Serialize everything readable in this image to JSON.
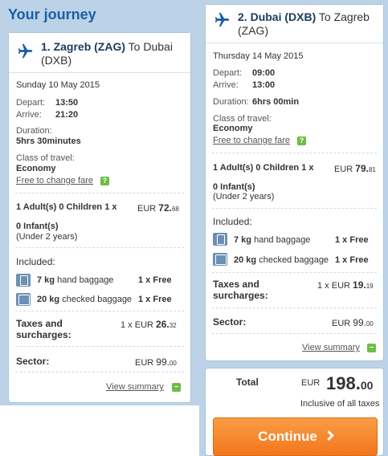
{
  "page": {
    "title": "Your journey"
  },
  "flights": [
    {
      "number": "1.",
      "from": "Zagreb (ZAG)",
      "to_word": "To",
      "to": "Dubai (DXB)",
      "date": "Sunday 10 May 2015",
      "depart_label": "Depart:",
      "depart_time": "13:50",
      "arrive_label": "Arrive:",
      "arrive_time": "21:20",
      "duration_label": "Duration:",
      "duration": "5hrs 30minutes",
      "class_label": "Class of travel:",
      "class": "Economy",
      "fare_link": "Free to change fare",
      "passengers": "1 Adult(s) 0 Children 1 x",
      "fare_currency": "EUR",
      "fare_main": "72.",
      "fare_cents": "68",
      "infants": "0 Infant(s)",
      "infants_note": "(Under 2 years)",
      "included_label": "Included:",
      "baggage": [
        {
          "weight": "7 kg",
          "desc": "hand baggage",
          "qty": "1 x Free"
        },
        {
          "weight": "20 kg",
          "desc": "checked baggage",
          "qty": "1 x Free"
        }
      ],
      "taxes_label_1": "Taxes and",
      "taxes_label_2": "surcharges:",
      "taxes_prefix": "1 x EUR",
      "taxes_main": "26.",
      "taxes_cents": "32",
      "sector_label": "Sector:",
      "sector_currency": "EUR",
      "sector_main": "99.",
      "sector_cents": "00",
      "summary_link": "View summary"
    },
    {
      "number": "2.",
      "from": "Dubai (DXB)",
      "to_word": "To",
      "to": "Zagreb (ZAG)",
      "date": "Thursday 14 May 2015",
      "depart_label": "Depart:",
      "depart_time": "09:00",
      "arrive_label": "Arrive:",
      "arrive_time": "13:00",
      "duration_label": "Duration:",
      "duration": "6hrs 00min",
      "class_label": "Class of travel:",
      "class": "Economy",
      "fare_link": "Free to change fare",
      "passengers": "1 Adult(s) 0 Children 1 x",
      "fare_currency": "EUR",
      "fare_main": "79.",
      "fare_cents": "81",
      "infants": "0 Infant(s)",
      "infants_note": "(Under 2 years)",
      "included_label": "Included:",
      "baggage": [
        {
          "weight": "7 kg",
          "desc": "hand baggage",
          "qty": "1 x Free"
        },
        {
          "weight": "20 kg",
          "desc": "checked baggage",
          "qty": "1 x Free"
        }
      ],
      "taxes_label_1": "Taxes and",
      "taxes_label_2": "surcharges:",
      "taxes_prefix": "1 x EUR",
      "taxes_main": "19.",
      "taxes_cents": "19",
      "sector_label": "Sector:",
      "sector_currency": "EUR",
      "sector_main": "99.",
      "sector_cents": "00",
      "summary_link": "View summary"
    }
  ],
  "total": {
    "label": "Total",
    "currency": "EUR",
    "main": "198.",
    "cents": "00",
    "note": "Inclusive of all taxes",
    "button": "Continue"
  },
  "icons": {
    "plane": "airplane-icon",
    "help": "question-icon",
    "collapse": "minus-icon",
    "bag_small": "hand-baggage-icon",
    "bag_large": "checked-baggage-icon",
    "chevron": "chevron-right-icon"
  },
  "colors": {
    "background": "#bcd3e7",
    "heading": "#1a5ea8",
    "accent_green": "#6bbd45",
    "button": "#f2761c"
  }
}
